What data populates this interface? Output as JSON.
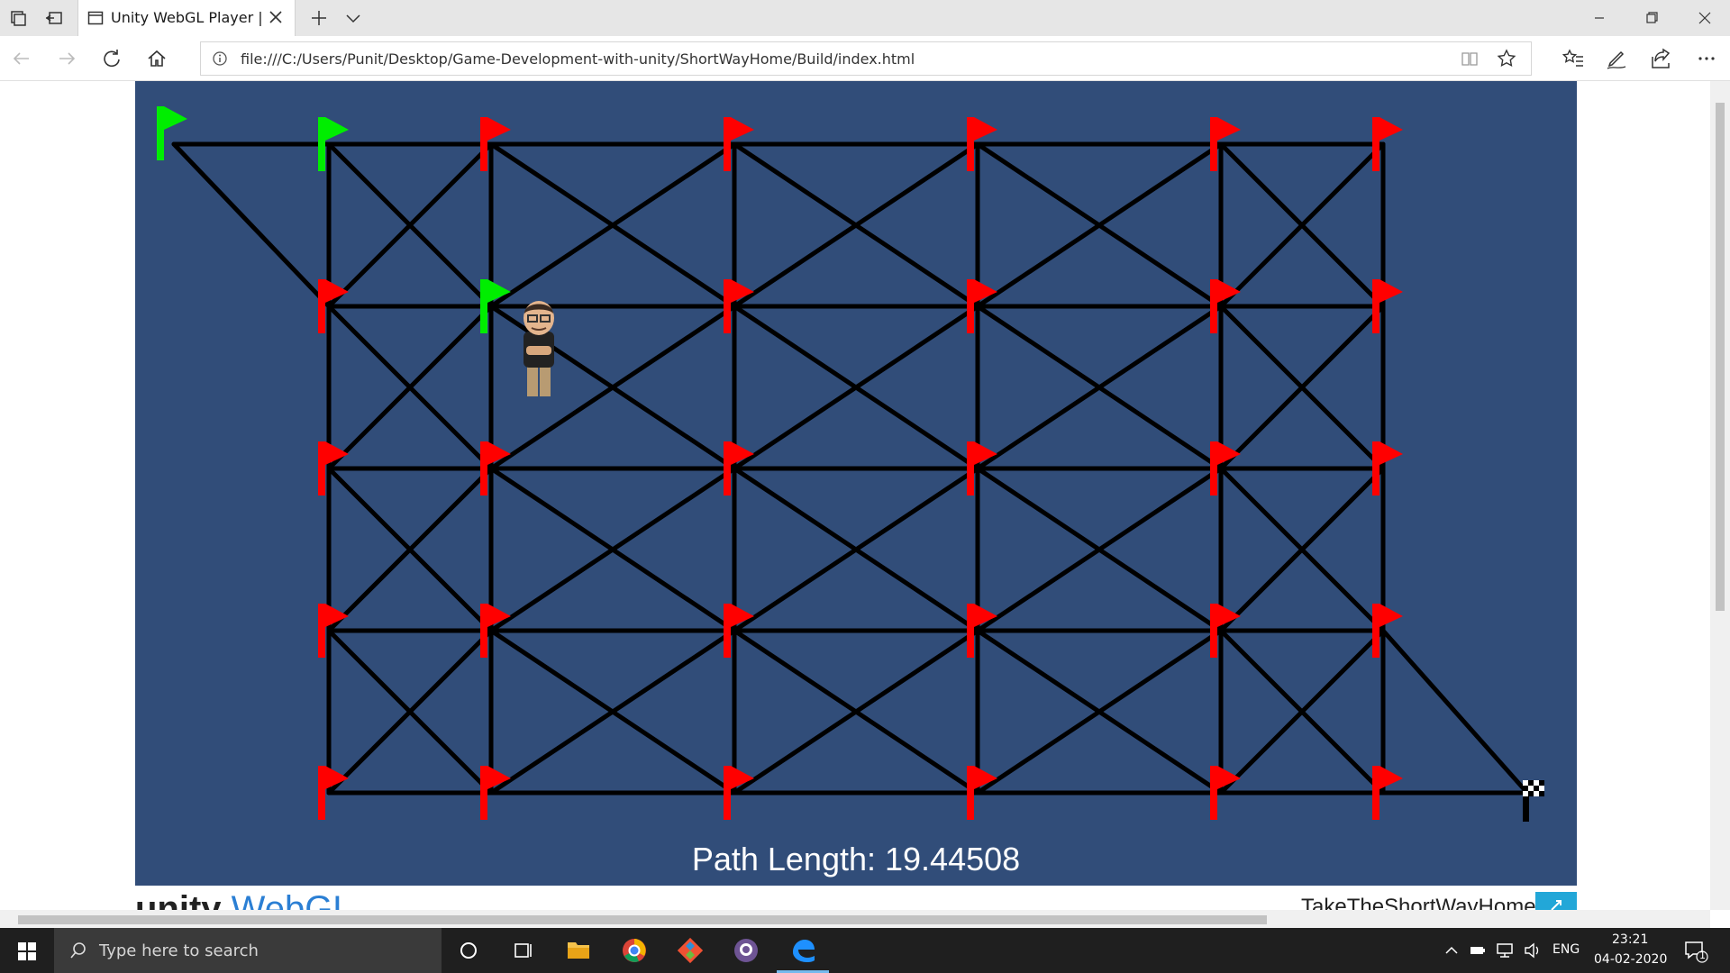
{
  "browser": {
    "tab_title": "Unity WebGL Player | Ta",
    "url": "file:///C:/Users/Punit/Desktop/Game-Development-with-unity/ShortWayHome/Build/index.html"
  },
  "game": {
    "path_length_text": "Path Length: 19.44508",
    "colors": {
      "background": "#314d79",
      "edge": "#000000",
      "visited_flag": "#00ee00",
      "unvisited_flag": "#ff0000"
    }
  },
  "footer": {
    "logo_unity": "unity",
    "logo_webgl": "WebGL",
    "game_title": "TakeTheShortWayHome"
  },
  "taskbar": {
    "search_placeholder": "Type here to search",
    "language": "ENG",
    "time": "23:21",
    "date": "04-02-2020",
    "notification_count": "1",
    "pinned_apps": [
      "task-view",
      "file-explorer",
      "chrome",
      "git",
      "github-desktop",
      "edge"
    ]
  }
}
